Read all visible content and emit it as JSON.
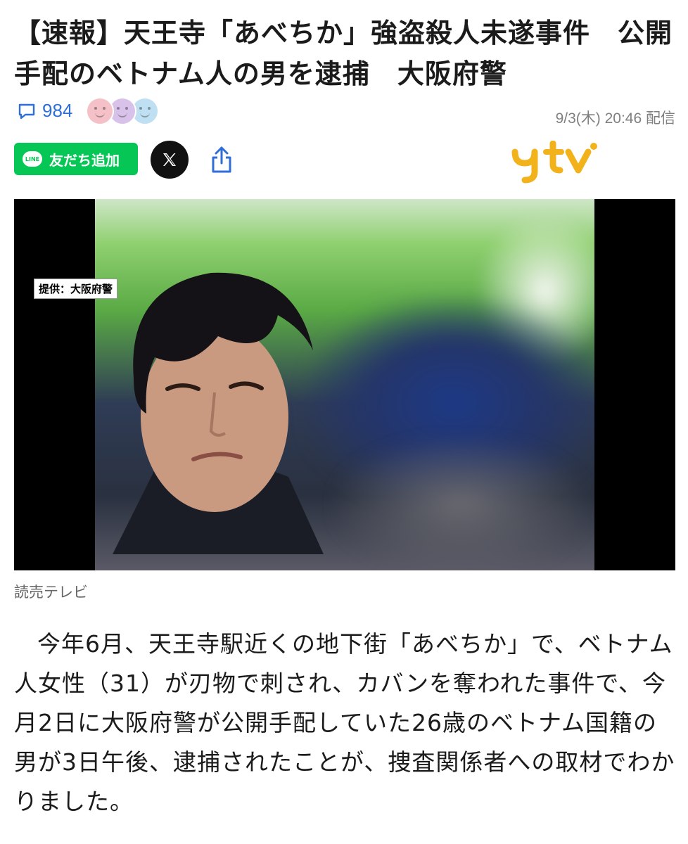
{
  "article": {
    "headline": "【速報】天王寺「あべちか」強盗殺人未遂事件　公開手配のベトナム人の男を逮捕　大阪府警",
    "comment_count": "984",
    "published": "9/3(木) 20:46 配信",
    "source_logo_text": "ytv"
  },
  "share": {
    "line_logo_text": "LINE",
    "line_label": "友だち追加"
  },
  "photo": {
    "credit_tag": "提供：大阪府警",
    "caption": "読売テレビ"
  },
  "body": {
    "paragraph": "今年6月、天王寺駅近くの地下街「あべちか」で、ベトナム人女性（31）が刃物で刺され、カバンを奪われた事件で、今月2日に大阪府警が公開手配していた26歳のベトナム国籍の男が3日午後、逮捕されたことが、捜査関係者への取材でわかりました。"
  },
  "colors": {
    "line_green": "#06c755",
    "link_blue": "#2e6ed6",
    "ytv_yellow": "#f2b21b",
    "reaction_pink": "#f5c1c8",
    "reaction_purple": "#d9c2ea",
    "reaction_blue": "#bfe0f2"
  },
  "icons": {
    "comment": "comment-bubble-icon",
    "reactions": [
      "smile-face-pink-icon",
      "smile-face-purple-icon",
      "smile-face-blue-icon"
    ],
    "x": "x-logo-icon",
    "share": "share-upload-icon"
  }
}
